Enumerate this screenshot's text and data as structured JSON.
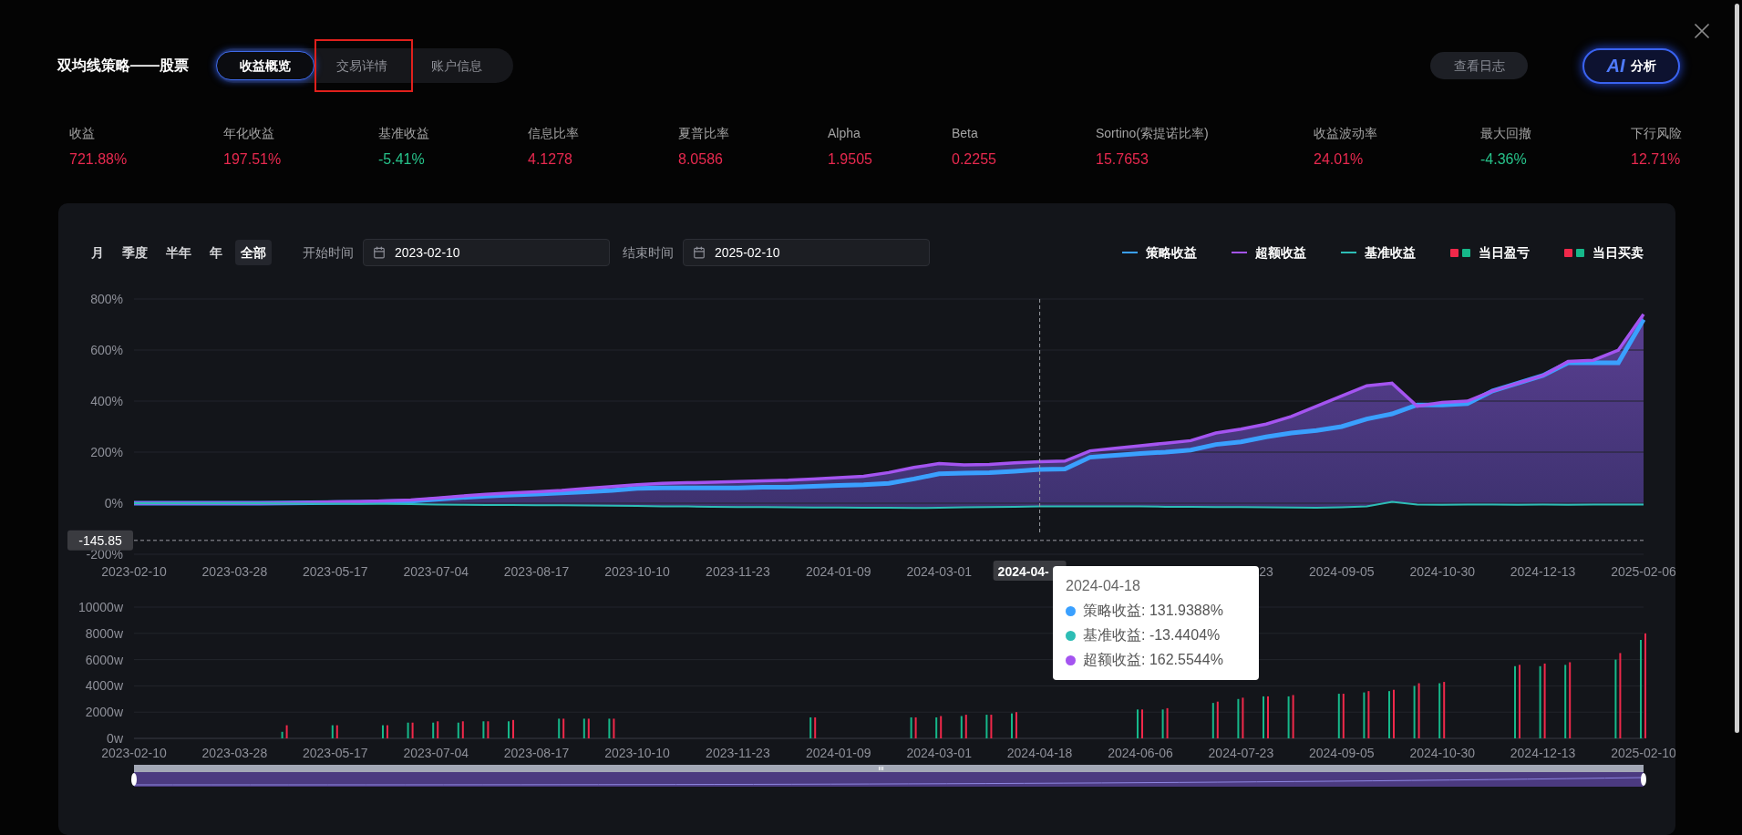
{
  "header": {
    "title": "双均线策略——股票",
    "tabs": [
      {
        "label": "收益概览",
        "selected": true,
        "highlighted": false
      },
      {
        "label": "交易详情",
        "selected": false,
        "highlighted": true
      },
      {
        "label": "账户信息",
        "selected": false,
        "highlighted": false
      }
    ],
    "log_button": "查看日志",
    "ai_button": {
      "badge": "AI",
      "label": "分析"
    }
  },
  "metrics": [
    {
      "label": "收益",
      "value": "721.88%",
      "color": "#e8294f"
    },
    {
      "label": "年化收益",
      "value": "197.51%",
      "color": "#e8294f"
    },
    {
      "label": "基准收益",
      "value": "-5.41%",
      "color": "#27c28a"
    },
    {
      "label": "信息比率",
      "value": "4.1278",
      "color": "#e8294f"
    },
    {
      "label": "夏普比率",
      "value": "8.0586",
      "color": "#e8294f"
    },
    {
      "label": "Alpha",
      "value": "1.9505",
      "color": "#e8294f"
    },
    {
      "label": "Beta",
      "value": "0.2255",
      "color": "#e8294f"
    },
    {
      "label": "Sortino(索提诺比率)",
      "value": "15.7653",
      "color": "#e8294f"
    },
    {
      "label": "收益波动率",
      "value": "24.01%",
      "color": "#e8294f"
    },
    {
      "label": "最大回撤",
      "value": "-4.36%",
      "color": "#27c28a"
    },
    {
      "label": "下行风险",
      "value": "12.71%",
      "color": "#e8294f"
    }
  ],
  "periods": [
    {
      "label": "月",
      "selected": false
    },
    {
      "label": "季度",
      "selected": false
    },
    {
      "label": "半年",
      "selected": false
    },
    {
      "label": "年",
      "selected": false
    },
    {
      "label": "全部",
      "selected": true
    }
  ],
  "start_date": {
    "label": "开始时间",
    "value": "2023-02-10"
  },
  "end_date": {
    "label": "结束时间",
    "value": "2025-02-10"
  },
  "legend": [
    {
      "label": "当日盈亏"
    },
    {
      "label": "当日买卖"
    }
  ],
  "return_chart": {
    "chart_data": {
      "type": "line",
      "grid": true,
      "categories": [
        "2023-02-10",
        null,
        null,
        null,
        "2023-03-28",
        null,
        null,
        null,
        "2023-05-17",
        null,
        null,
        null,
        "2023-07-04",
        null,
        null,
        null,
        "2023-08-17",
        null,
        null,
        null,
        "2023-10-10",
        null,
        null,
        null,
        "2023-11-23",
        null,
        null,
        null,
        "2024-01-09",
        null,
        null,
        null,
        "2024-03-01",
        null,
        null,
        null,
        null,
        null,
        null,
        null,
        null,
        null,
        null,
        null,
        null,
        "23",
        null,
        null,
        "2024-09-05",
        null,
        null,
        null,
        "2024-10-30",
        null,
        null,
        null,
        "2024-12-13",
        null,
        null,
        null,
        "2025-02-06"
      ],
      "series": [
        {
          "name": "策略收益",
          "color": "#3aa0ff",
          "values": [
            0,
            0,
            0,
            0,
            0,
            0,
            1,
            2,
            3,
            4,
            6,
            8,
            15,
            22,
            28,
            32,
            36,
            40,
            45,
            50,
            58,
            60,
            60,
            60,
            60,
            62,
            62,
            66,
            70,
            72,
            78,
            95,
            115,
            118,
            120,
            125,
            132,
            134,
            180,
            188,
            195,
            200,
            208,
            230,
            240,
            260,
            275,
            285,
            300,
            330,
            350,
            385,
            385,
            390,
            440,
            470,
            500,
            550,
            550,
            550,
            720
          ]
        },
        {
          "name": "超额收益",
          "color": "#a454f0",
          "values": [
            0,
            0,
            0,
            0,
            0,
            0,
            1,
            3,
            5,
            6,
            9,
            12,
            20,
            28,
            35,
            40,
            45,
            50,
            58,
            65,
            72,
            78,
            80,
            82,
            85,
            88,
            90,
            95,
            100,
            105,
            120,
            140,
            155,
            150,
            152,
            158,
            163,
            165,
            205,
            215,
            225,
            235,
            245,
            275,
            290,
            310,
            340,
            380,
            420,
            460,
            470,
            380,
            395,
            400,
            440,
            470,
            500,
            555,
            560,
            600,
            740
          ]
        },
        {
          "name": "基准收益",
          "color": "#2dbdb5",
          "values": [
            0,
            0,
            0,
            0,
            0,
            0,
            -1,
            -2,
            -2,
            -3,
            -3,
            -4,
            -5,
            -6,
            -7,
            -7,
            -8,
            -8,
            -9,
            -10,
            -11,
            -12,
            -13,
            -14,
            -15,
            -15,
            -16,
            -17,
            -17,
            -18,
            -18,
            -19,
            -18,
            -16,
            -15,
            -14,
            -13,
            -13,
            -12,
            -12,
            -13,
            -14,
            -14,
            -15,
            -15,
            -16,
            -17,
            -18,
            -16,
            -12,
            5,
            -5,
            -6,
            -5,
            -5,
            -6,
            -5,
            -6,
            -5,
            -5,
            -5
          ]
        }
      ],
      "ylim": [
        -200,
        800
      ],
      "yticks": [
        {
          "value": -200,
          "label": "-200%"
        },
        {
          "value": 0,
          "label": "0%"
        },
        {
          "value": 200,
          "label": "200%"
        },
        {
          "value": 400,
          "label": "400%"
        },
        {
          "value": 600,
          "label": "600%"
        },
        {
          "value": 800,
          "label": "800%"
        }
      ]
    },
    "pointer_labels": [
      "2024-04-",
      "-145.85"
    ],
    "tooltip": {
      "title": "2024-04-18",
      "rows": [
        {
          "text": "策略收益: 131.9388%",
          "color": "#3aa0ff"
        },
        {
          "text": "基准收益: -13.4404%",
          "color": "#2dbdb5"
        },
        {
          "text": "超额收益: 162.5544%",
          "color": "#a454f0"
        }
      ]
    }
  },
  "volume_chart": {
    "chart_data": {
      "type": "bar",
      "grid": true,
      "categories": [
        "2023-02-10",
        null,
        null,
        null,
        "2023-03-28",
        null,
        null,
        null,
        "2023-05-17",
        null,
        null,
        null,
        "2023-07-04",
        null,
        null,
        null,
        "2023-08-17",
        null,
        null,
        null,
        "2023-10-10",
        null,
        null,
        null,
        "2023-11-23",
        null,
        null,
        null,
        "2024-01-09",
        null,
        null,
        null,
        "2024-03-01",
        null,
        null,
        null,
        "2024-04-18",
        null,
        null,
        null,
        "2024-06-06",
        null,
        null,
        null,
        "2024-07-23",
        null,
        null,
        null,
        "2024-09-05",
        null,
        null,
        null,
        "2024-10-30",
        null,
        null,
        null,
        "2024-12-13",
        null,
        null,
        null,
        "2025-02-10"
      ],
      "series": [
        {
          "color": "#16b88a",
          "values": [
            null,
            null,
            null,
            null,
            null,
            null,
            500,
            null,
            1000,
            null,
            1000,
            1200,
            1200,
            1200,
            1300,
            1300,
            null,
            1500,
            1500,
            1500,
            null,
            null,
            null,
            null,
            null,
            null,
            null,
            1600,
            null,
            null,
            null,
            1600,
            1600,
            1700,
            1800,
            1900,
            null,
            null,
            null,
            null,
            2200,
            2200,
            null,
            2700,
            3000,
            3200,
            3200,
            null,
            3400,
            3500,
            3600,
            4000,
            4200,
            null,
            null,
            5500,
            5500,
            5600,
            null,
            6000,
            7500
          ]
        },
        {
          "color": "#f0284a",
          "values": [
            null,
            null,
            null,
            null,
            null,
            null,
            1000,
            null,
            1000,
            null,
            1000,
            1200,
            1300,
            1300,
            1300,
            1400,
            null,
            1500,
            1500,
            1500,
            null,
            null,
            null,
            null,
            null,
            null,
            null,
            1600,
            null,
            null,
            null,
            1600,
            1700,
            1800,
            1800,
            2000,
            null,
            null,
            null,
            null,
            2200,
            2300,
            null,
            2800,
            3100,
            3200,
            3300,
            null,
            3400,
            3600,
            3700,
            4200,
            4300,
            null,
            null,
            5600,
            5700,
            5800,
            null,
            6500,
            8000
          ]
        }
      ],
      "ylim": [
        0,
        10000
      ],
      "yticks": [
        {
          "value": 0,
          "label": "0w"
        },
        {
          "value": 2000,
          "label": "2000w"
        },
        {
          "value": 4000,
          "label": "4000w"
        },
        {
          "value": 6000,
          "label": "6000w"
        },
        {
          "value": 8000,
          "label": "8000w"
        },
        {
          "value": 10000,
          "label": "10000w"
        }
      ]
    }
  }
}
